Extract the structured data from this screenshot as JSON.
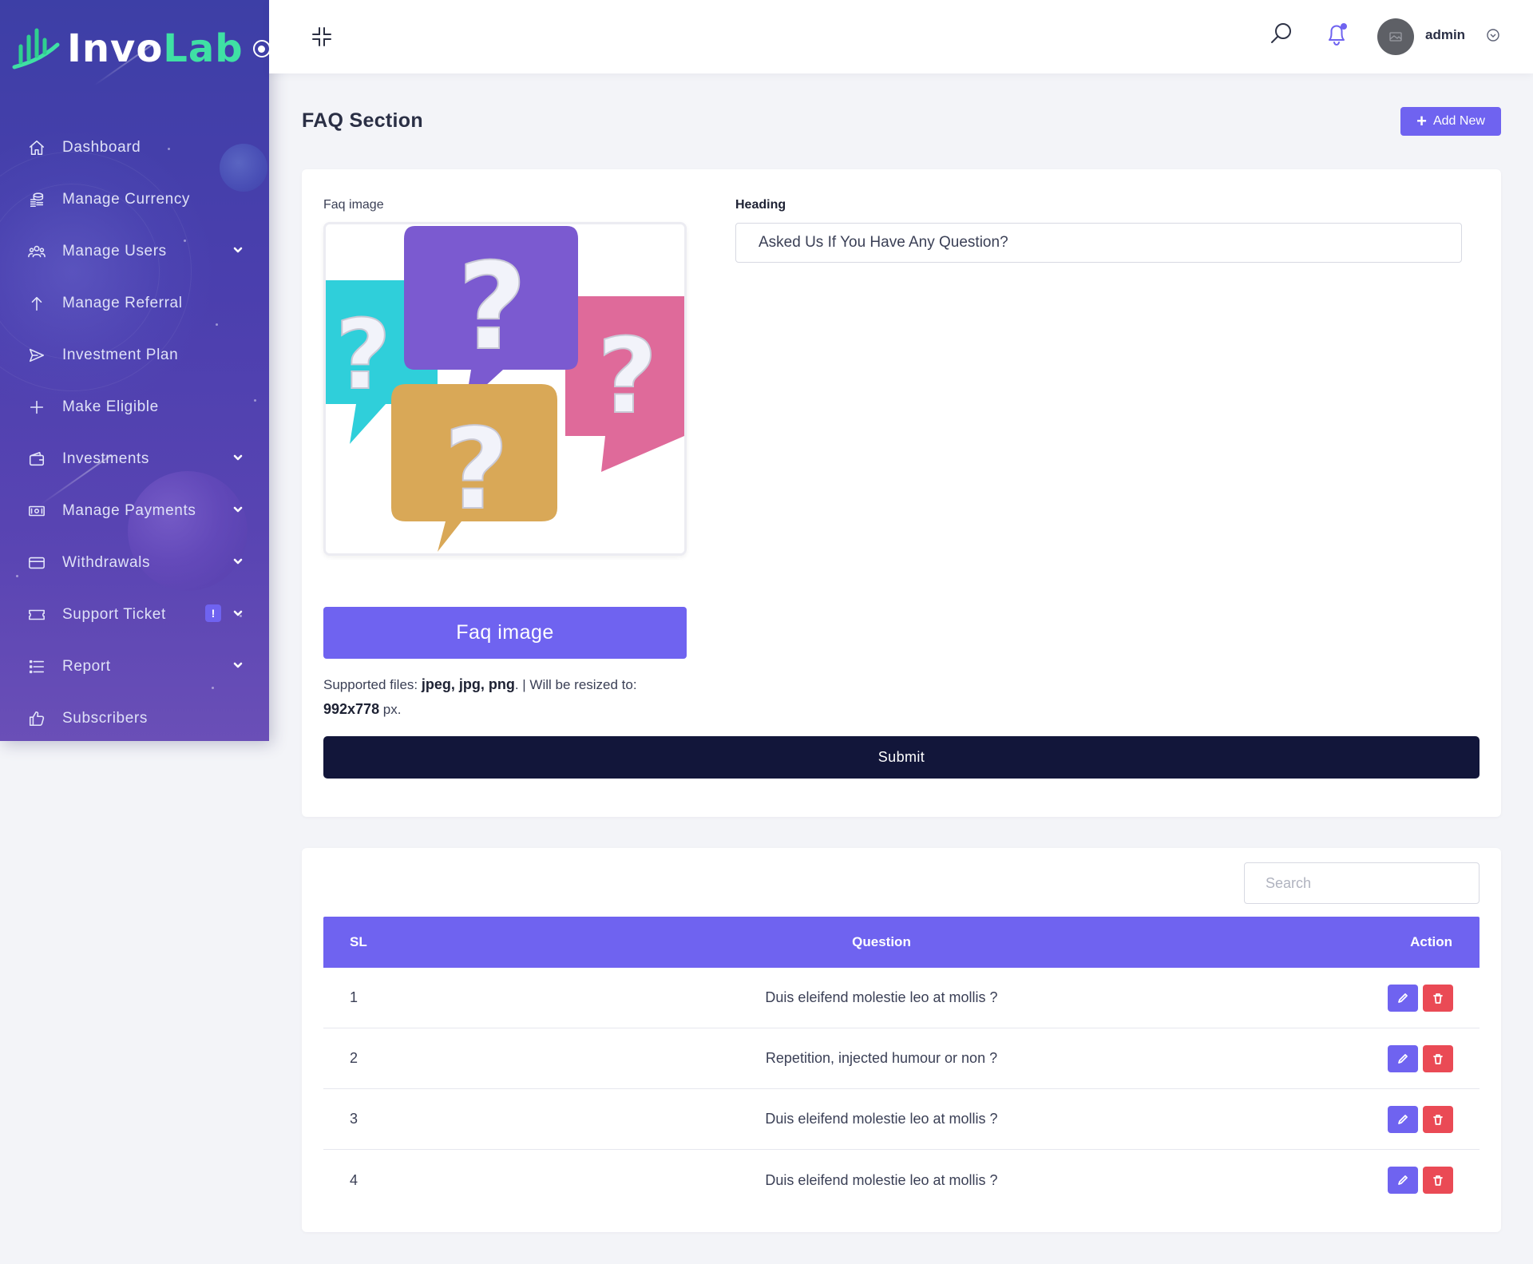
{
  "brand": {
    "name_part1": "Invo",
    "name_part2": "Lab",
    "accent": "#6f63f0",
    "logo_green": "#3fe0a4",
    "sidebar_top": "#3d3fa6",
    "sidebar_bottom": "#6a4fb7"
  },
  "sidebar": {
    "items": [
      {
        "label": "Dashboard",
        "icon": "home-icon",
        "has_caret": false
      },
      {
        "label": "Manage Currency",
        "icon": "coins-icon",
        "has_caret": false
      },
      {
        "label": "Manage Users",
        "icon": "users-icon",
        "has_caret": true
      },
      {
        "label": "Manage Referral",
        "icon": "arrow-up-icon",
        "has_caret": false
      },
      {
        "label": "Investment Plan",
        "icon": "send-icon",
        "has_caret": false
      },
      {
        "label": "Make Eligible",
        "icon": "plus-icon",
        "has_caret": false
      },
      {
        "label": "Investments",
        "icon": "wallet-icon",
        "has_caret": true
      },
      {
        "label": "Manage Payments",
        "icon": "money-icon",
        "has_caret": true
      },
      {
        "label": "Withdrawals",
        "icon": "credit-card-icon",
        "has_caret": true
      },
      {
        "label": "Support Ticket",
        "icon": "ticket-icon",
        "has_caret": true,
        "badge": "!"
      },
      {
        "label": "Report",
        "icon": "list-icon",
        "has_caret": true
      },
      {
        "label": "Subscribers",
        "icon": "thumbs-up-icon",
        "has_caret": false
      }
    ]
  },
  "topbar": {
    "user_name": "admin"
  },
  "page": {
    "title": "FAQ Section",
    "add_new_label": "Add New"
  },
  "form": {
    "image_label": "Faq image",
    "upload_button_label": "Faq image",
    "supported_prefix": "Supported files: ",
    "supported_types": "jpeg, jpg, png",
    "supported_mid": ". | Will be resized to: ",
    "resize_dims": "992x778",
    "resize_unit": " px.",
    "heading_label": "Heading",
    "heading_value": "Asked Us If You Have Any Question?",
    "submit_label": "Submit"
  },
  "table": {
    "search_placeholder": "Search",
    "headers": {
      "sl": "SL",
      "question": "Question",
      "action": "Action"
    },
    "rows": [
      {
        "sl": "1",
        "question": "Duis eleifend molestie leo at mollis ?"
      },
      {
        "sl": "2",
        "question": "Repetition, injected humour or non ?"
      },
      {
        "sl": "3",
        "question": "Duis eleifend molestie leo at mollis ?"
      },
      {
        "sl": "4",
        "question": "Duis eleifend molestie leo at mollis ?"
      }
    ]
  }
}
